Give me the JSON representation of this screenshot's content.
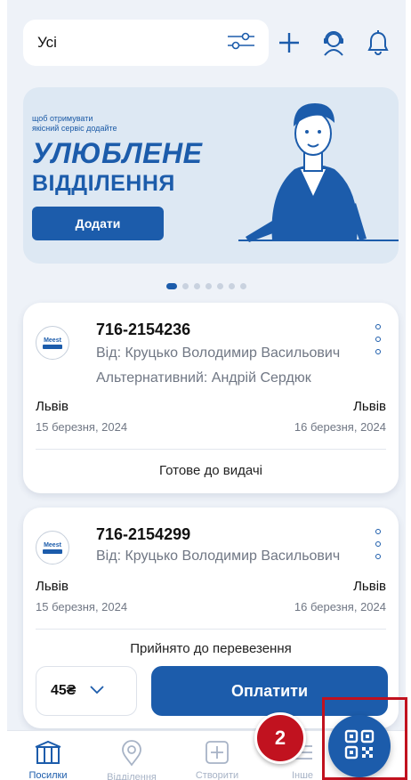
{
  "header": {
    "filter_label": "Усі",
    "filter_icon": "sliders-icon",
    "add_icon": "plus-icon",
    "support_icon": "support-agent-icon",
    "notification_icon": "bell-icon"
  },
  "banner": {
    "small_text_line1": "щоб отримувати",
    "small_text_line2": "якісний сервіс додайте",
    "title_line1": "УЛЮБЛЕНЕ",
    "title_line2": "ВІДДІЛЕННЯ",
    "button_label": "Додати",
    "active_slide": 1,
    "slide_count": 7
  },
  "parcels": [
    {
      "logo_text": "Meest",
      "tracking": "716-2154236",
      "sender": "Від: Круцько Володимир Васильович",
      "alternative": "Альтернативний: Андрій Сердюк",
      "from_city": "Львів",
      "from_date": "15 березня, 2024",
      "to_city": "Львів",
      "to_date": "16 березня, 2024",
      "status": "Готове до видачі"
    },
    {
      "logo_text": "Meest",
      "tracking": "716-2154299",
      "sender": "Від: Круцько Володимир Васильович",
      "from_city": "Львів",
      "from_date": "15 березня, 2024",
      "to_city": "Львів",
      "to_date": "16 березня, 2024",
      "status": "Прийнято до перевезення",
      "amount": "45₴",
      "pay_label": "Оплатити"
    }
  ],
  "bottom_nav": {
    "items": [
      {
        "label": "Посилки",
        "icon": "parcel-box-icon"
      },
      {
        "label": "Відділення",
        "icon": "location-pin-icon"
      },
      {
        "label": "Створити",
        "icon": "plus-square-icon"
      },
      {
        "label": "Інше",
        "icon": "menu-icon"
      }
    ],
    "qr_icon": "qr-code-icon"
  },
  "annotation": {
    "step_number": "2",
    "color": "#c1121f"
  },
  "colors": {
    "brand_blue": "#1c5cab",
    "background": "#eef2f8"
  }
}
